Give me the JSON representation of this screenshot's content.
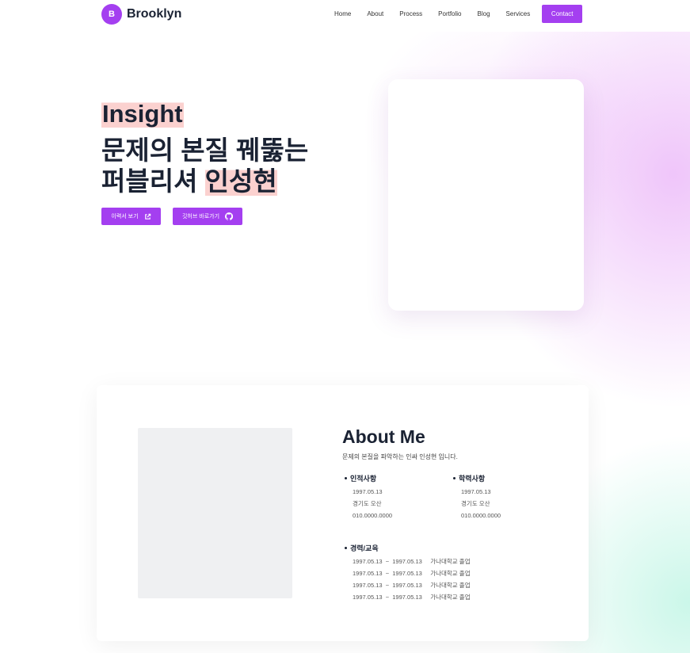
{
  "nav": {
    "brand_badge": "B",
    "brand_name": "Brooklyn",
    "links": [
      "Home",
      "About",
      "Process",
      "Portfolio",
      "Blog",
      "Services"
    ],
    "contact_label": "Contact"
  },
  "hero": {
    "tag": "Insight",
    "title_line1": "문제의 본질 꿰뚫는",
    "title_line2_prefix": "퍼블리셔 ",
    "title_line2_highlight": "인성현",
    "resume_button": "이력서 보기",
    "github_button": "깃허브 바로가기"
  },
  "about": {
    "title": "About Me",
    "subtitle": "문제의 본질을 파악하는 인싸 인성현 입니다.",
    "personal": {
      "heading": "인적사항",
      "lines": [
        "1997.05.13",
        "경기도 오산",
        "010.0000.0000"
      ]
    },
    "education": {
      "heading": "학력사항",
      "lines": [
        "1997.05.13",
        "경기도 오산",
        "010.0000.0000"
      ]
    },
    "career": {
      "heading": "경력/교육",
      "rows": [
        "1997.05.13  ~  1997.05.13     가나대학교 졸업",
        "1997.05.13  ~  1997.05.13     가나대학교 졸업",
        "1997.05.13  ~  1997.05.13     가나대학교 졸업",
        "1997.05.13  ~  1997.05.13     가나대학교 졸업"
      ]
    }
  },
  "colors": {
    "accent": "#a43ff0",
    "highlight": "#fbd1cf",
    "text": "#1a2233"
  },
  "icons": {
    "resume_button_icon": "external-link-icon",
    "github_button_icon": "github-icon"
  }
}
